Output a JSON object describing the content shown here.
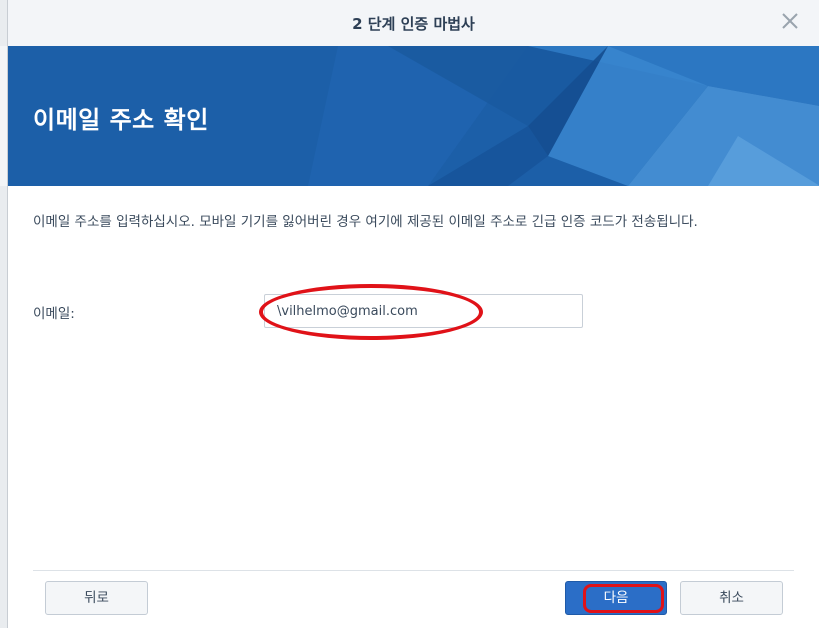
{
  "dialog": {
    "title": "2 단계 인증 마법사",
    "close_icon": "close-icon"
  },
  "banner": {
    "heading": "이메일 주소 확인"
  },
  "content": {
    "description": "이메일 주소를 입력하십시오. 모바일 기기를 잃어버린 경우 여기에 제공된 이메일 주소로 긴급 인증 코드가 전송됩니다.",
    "email_label": "이메일:",
    "email_value": "\\vilhelmo@gmail.com"
  },
  "footer": {
    "back_label": "뒤로",
    "next_label": "다음",
    "cancel_label": "취소"
  },
  "colors": {
    "accent": "#2b6ec7",
    "banner": "#1c5fa8",
    "annotation": "#e01218"
  }
}
